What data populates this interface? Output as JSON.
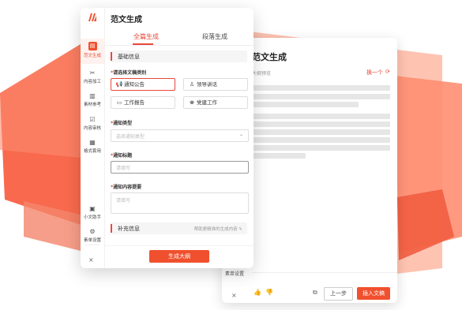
{
  "colors": {
    "accent": "#f0502e",
    "shape_light": "#ffb39e",
    "shape_mid": "#ff8a6e",
    "shape_dark": "#f55a3c"
  },
  "front": {
    "title": "范文生成",
    "tabs": [
      {
        "label": "全篇生成",
        "active": true
      },
      {
        "label": "段落生成",
        "active": false
      }
    ],
    "section_basic": "基础信息",
    "type_label": "请选择文稿类别",
    "doc_types": [
      {
        "label": "通知公告",
        "icon": "megaphone-icon",
        "selected": true
      },
      {
        "label": "领导讲话",
        "icon": "speaker-icon",
        "selected": false
      },
      {
        "label": "工作报告",
        "icon": "report-icon",
        "selected": false
      },
      {
        "label": "党建工作",
        "icon": "party-icon",
        "selected": false
      }
    ],
    "notice_type_label": "通知类型",
    "notice_type_placeholder": "选择通知类型",
    "notice_title_label": "通知标题",
    "notice_title_placeholder": "请填写",
    "notice_content_label": "通知内容提要",
    "notice_content_placeholder": "请填写",
    "section_extra": "补充信息",
    "section_extra_hint": "帮助更精准的生成内容",
    "generate_button": "生成大纲",
    "sidebar": [
      {
        "label": "范文生成",
        "icon": "document-icon",
        "active": true
      },
      {
        "label": "内容加工",
        "icon": "tools-icon",
        "active": false
      },
      {
        "label": "素材参考",
        "icon": "library-icon",
        "active": false
      },
      {
        "label": "内容审核",
        "icon": "review-icon",
        "active": false
      },
      {
        "label": "格式套用",
        "icon": "format-icon",
        "active": false
      },
      {
        "label": "小文助手",
        "icon": "assistant-icon",
        "active": false
      },
      {
        "label": "素单设置",
        "icon": "settings-icon",
        "active": false
      }
    ],
    "close": "×"
  },
  "back": {
    "title": "范文生成",
    "subtitle": "大纲预览",
    "swap_label": "换一个",
    "side_label": "素单设置",
    "close": "×",
    "prev_button": "上一步",
    "insert_button": "插入文稿"
  }
}
